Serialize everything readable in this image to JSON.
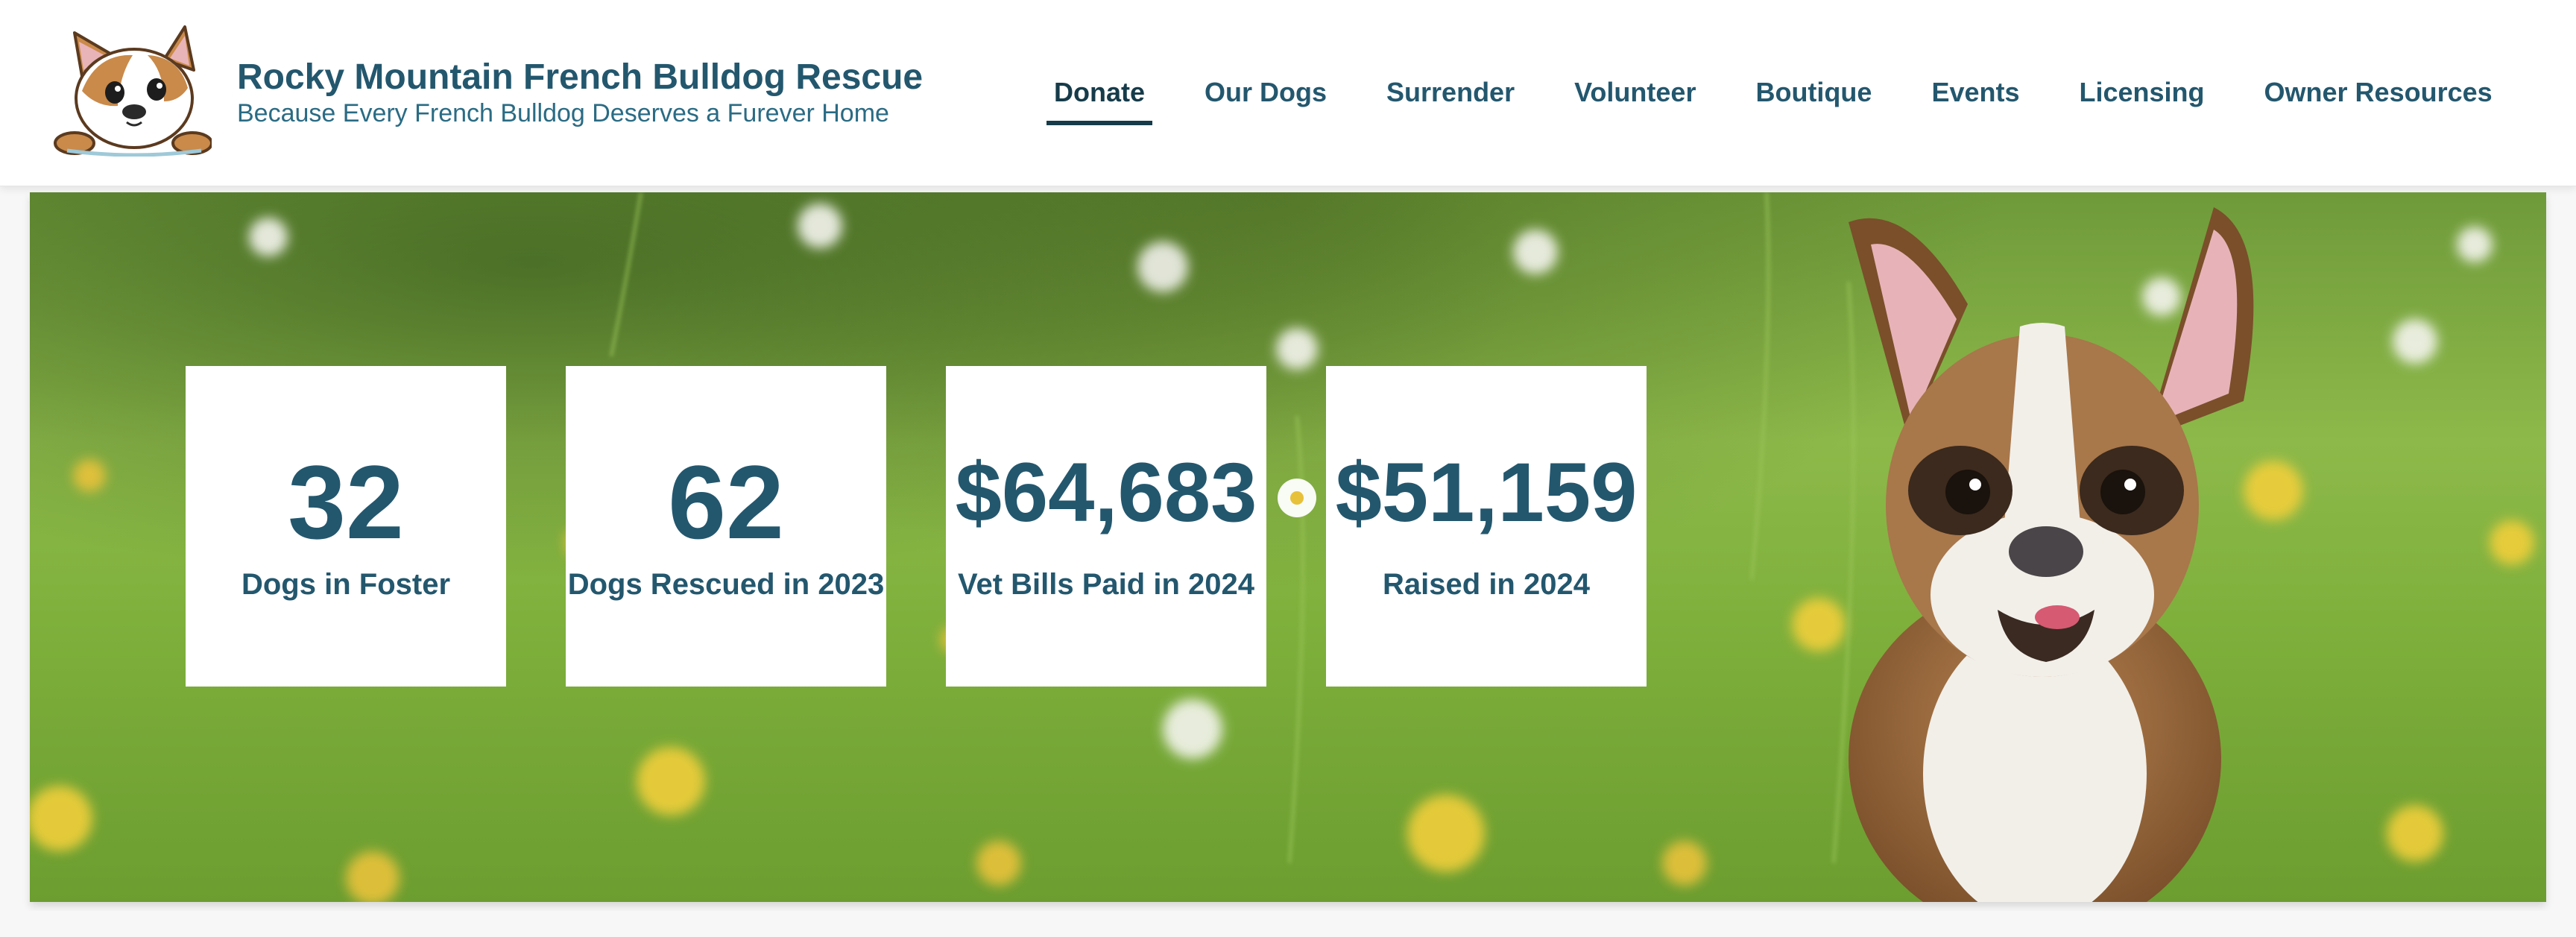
{
  "header": {
    "title": "Rocky Mountain French Bulldog Rescue",
    "tagline": "Because Every French Bulldog Deserves a Furever Home",
    "logo_icon": "french-bulldog-cartoon-logo"
  },
  "nav": {
    "items": [
      {
        "label": "Donate",
        "active": true
      },
      {
        "label": "Our Dogs"
      },
      {
        "label": "Surrender"
      },
      {
        "label": "Volunteer"
      },
      {
        "label": "Boutique"
      },
      {
        "label": "Events"
      },
      {
        "label": "Licensing"
      },
      {
        "label": "Owner Resources"
      }
    ]
  },
  "hero": {
    "image_icon": "french-bulldog-in-meadow-photo",
    "stats": [
      {
        "value": "32",
        "label": "Dogs in Foster"
      },
      {
        "value": "62",
        "label": "Dogs Rescued in 2023"
      },
      {
        "value": "$64,683",
        "label": "Vet Bills Paid in 2024"
      },
      {
        "value": "$51,159",
        "label": "Raised in 2024"
      }
    ]
  },
  "colors": {
    "brand_text": "#23576e",
    "nav_active": "#163b4a",
    "card_bg": "#ffffff",
    "page_bg": "#f7f7f7"
  }
}
